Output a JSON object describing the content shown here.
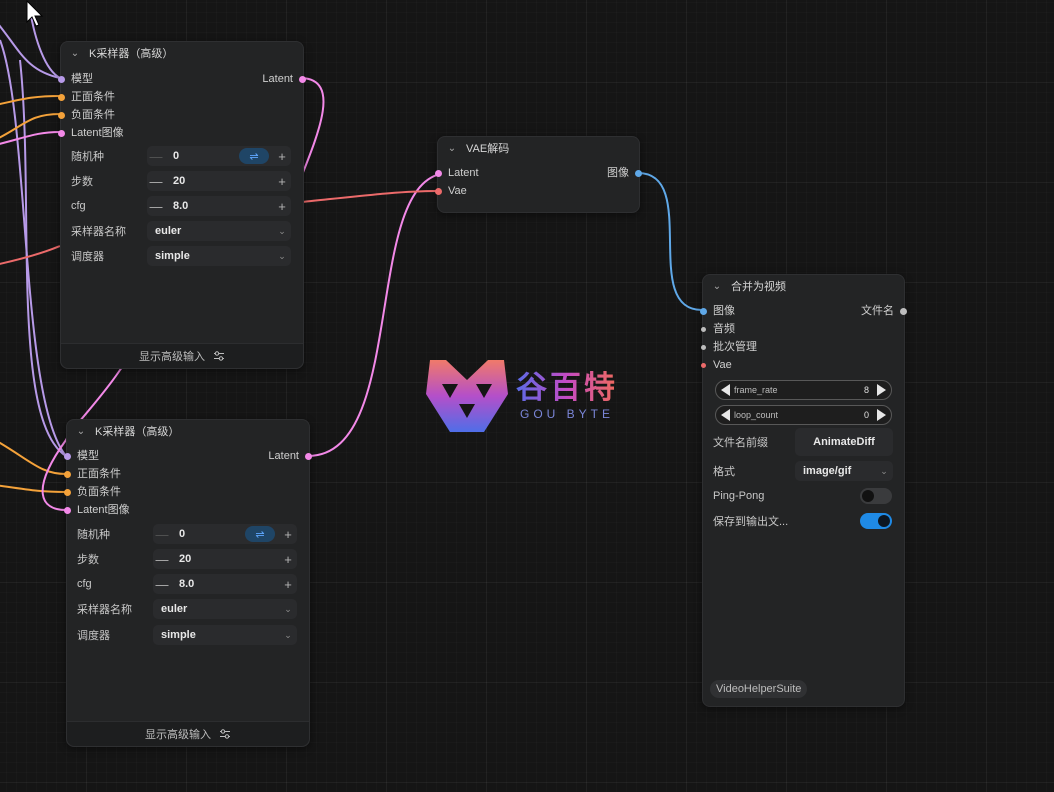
{
  "colors": {
    "model": "#b79ae8",
    "conditioning": "#f4a23a",
    "latent": "#f389e8",
    "vae": "#ec6a6a",
    "image": "#5fa8e8",
    "filename": "#bdbdbd",
    "audio": "#bdbdbd",
    "batch": "#bdbdbd",
    "toggle_on": "#1f8ae6",
    "toggle_off": "#3a3b3d"
  },
  "ksampler1": {
    "title": "K采样器（高级）",
    "inputs": [
      "模型",
      "正面条件",
      "负面条件",
      "Latent图像"
    ],
    "output": "Latent",
    "widgets": {
      "seed_label": "随机种",
      "seed_value": "0",
      "steps_label": "步数",
      "steps_value": "20",
      "cfg_label": "cfg",
      "cfg_value": "8.0",
      "sampler_label": "采样器名称",
      "sampler_value": "euler",
      "scheduler_label": "调度器",
      "scheduler_value": "simple"
    },
    "footer": "显示高级输入"
  },
  "ksampler2": {
    "title": "K采样器（高级）",
    "inputs": [
      "模型",
      "正面条件",
      "负面条件",
      "Latent图像"
    ],
    "output": "Latent",
    "widgets": {
      "seed_label": "随机种",
      "seed_value": "0",
      "steps_label": "步数",
      "steps_value": "20",
      "cfg_label": "cfg",
      "cfg_value": "8.0",
      "sampler_label": "采样器名称",
      "sampler_value": "euler",
      "scheduler_label": "调度器",
      "scheduler_value": "simple"
    },
    "footer": "显示高级输入"
  },
  "vae_decode": {
    "title": "VAE解码",
    "inputs": [
      "Latent",
      "Vae"
    ],
    "output": "图像"
  },
  "video_combine": {
    "title": "合并为视频",
    "inputs": [
      "图像",
      "音频",
      "批次管理",
      "Vae"
    ],
    "output": "文件名",
    "frame_rate_label": "frame_rate",
    "frame_rate_value": "8",
    "loop_count_label": "loop_count",
    "loop_count_value": "0",
    "prefix_label": "文件名前缀",
    "prefix_value": "AnimateDiff",
    "format_label": "格式",
    "format_value": "image/gif",
    "pingpong_label": "Ping-Pong",
    "pingpong_on": false,
    "save_label": "保存到输出文...",
    "save_on": true,
    "badge": "VideoHelperSuite"
  },
  "watermark": {
    "cn": "谷百特",
    "en": "GOU BYTE"
  },
  "icons": {
    "collapse": "chevron-down-icon",
    "shuffle": "shuffle-icon",
    "tune": "sliders-icon",
    "cursor": "mouse-pointer-icon"
  }
}
